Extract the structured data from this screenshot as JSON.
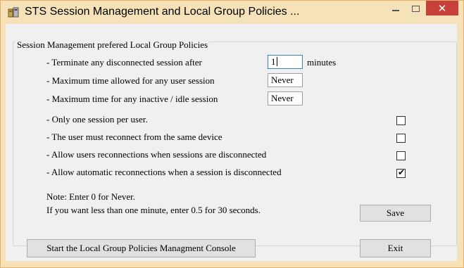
{
  "window": {
    "title": "STS Session Management and Local Group Policies ...",
    "close_glyph": "✕"
  },
  "group": {
    "title": "Session Management prefered Local Group Policies"
  },
  "settings": {
    "terminate_label": "- Terminate any disconnected session after",
    "terminate_value": "1",
    "terminate_unit": "minutes",
    "max_session_label": "- Maximum time allowed for any user session",
    "max_session_value": "Never",
    "max_idle_label": "- Maximum time for any inactive / idle session",
    "max_idle_value": "Never"
  },
  "checkboxes": [
    {
      "label": "- Only one session per user.",
      "checked": false
    },
    {
      "label": "- The user must reconnect from the same device",
      "checked": false
    },
    {
      "label": "- Allow users reconnections when sessions are disconnected",
      "checked": false
    },
    {
      "label": "- Allow automatic reconnections when a session is disconnected",
      "checked": true
    }
  ],
  "check_glyph": "✔",
  "notes": {
    "line1": "Note: Enter 0 for Never.",
    "line2": "If you want less than one minute, enter 0.5 for 30 seconds."
  },
  "buttons": {
    "save": "Save",
    "start_console": "Start the Local Group Policies Managment Console",
    "exit": "Exit"
  }
}
